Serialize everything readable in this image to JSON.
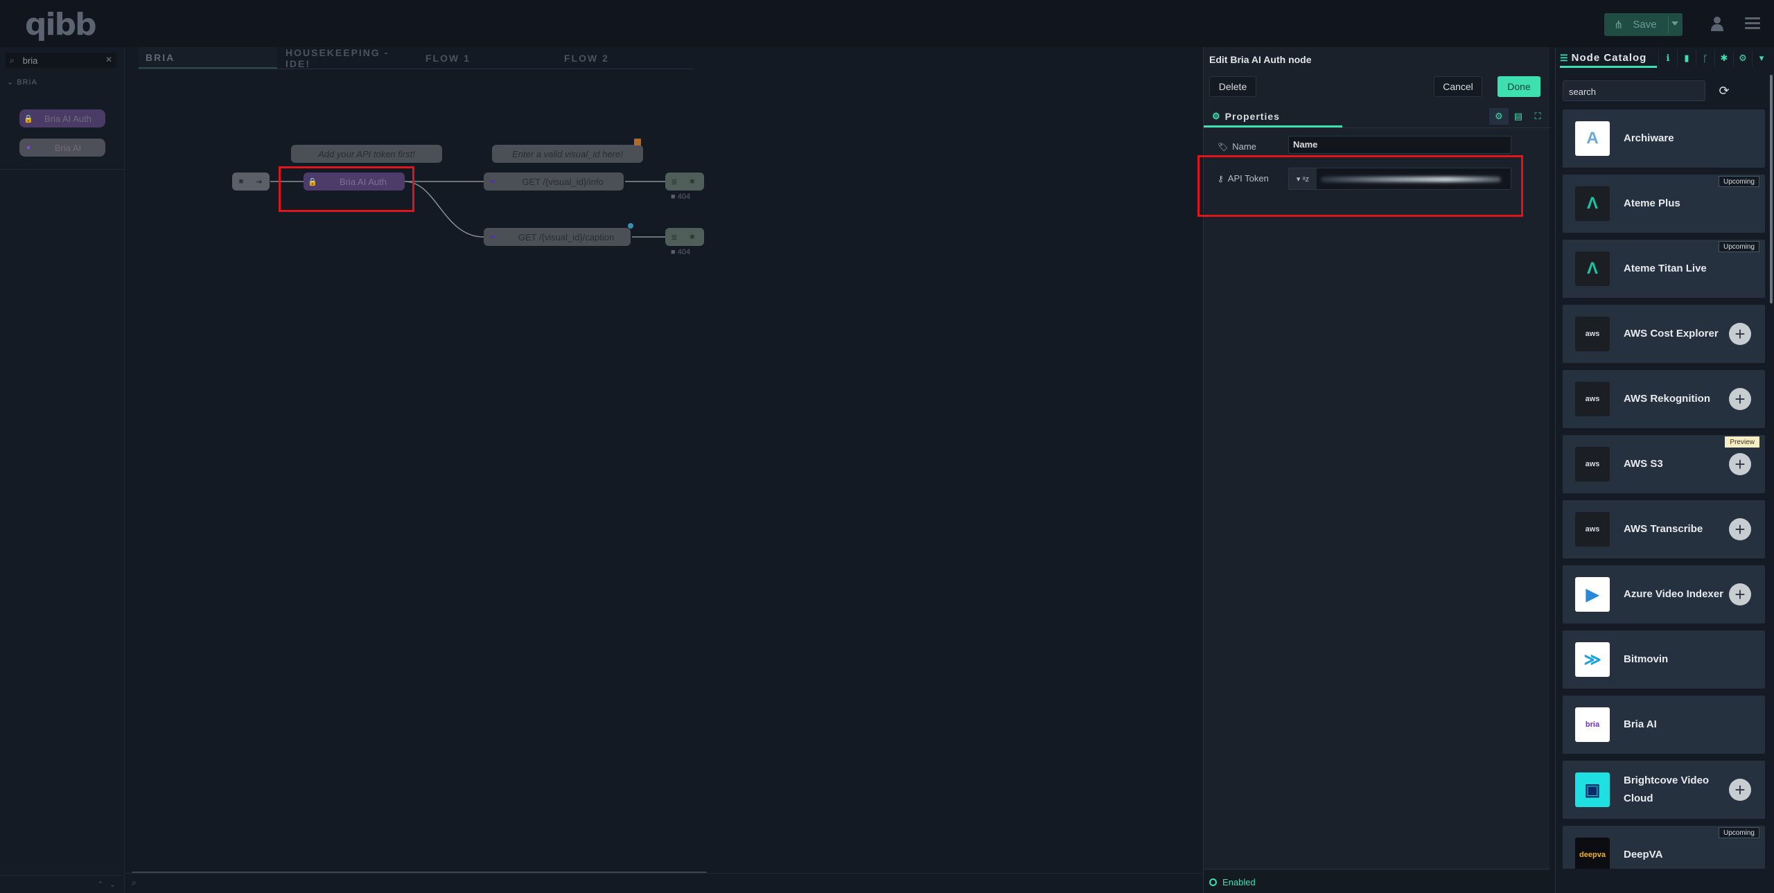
{
  "app": {
    "logo": "qibb"
  },
  "header": {
    "save_label": "Save"
  },
  "palette": {
    "search_value": "bria",
    "category": "BRIA",
    "nodes": [
      {
        "label": "Bria AI Auth"
      },
      {
        "label": "Bria AI"
      }
    ]
  },
  "workspace": {
    "tabs": [
      {
        "label": "BRIA"
      },
      {
        "label": "HOUSEKEEPING - IDE!"
      },
      {
        "label": "FLOW 1"
      },
      {
        "label": "FLOW 2"
      }
    ],
    "comments": [
      {
        "text": "Add your API token first!"
      },
      {
        "text": "Enter a valid visual_id here!"
      }
    ],
    "nodes": {
      "auth": "Bria AI Auth",
      "info": "GET /{visual_id}/info",
      "caption": "GET /{visual_id}/caption",
      "status_1": "404",
      "status_2": "404"
    }
  },
  "edit": {
    "title": "Edit Bria AI Auth node",
    "delete_label": "Delete",
    "cancel_label": "Cancel",
    "done_label": "Done",
    "properties_tab": "Properties",
    "name_label": "Name",
    "name_placeholder": "Name",
    "token_label": "API Token",
    "enabled_label": "Enabled"
  },
  "catalog": {
    "tab_label": "Node Catalog",
    "search_placeholder": "search",
    "items": [
      {
        "name": "Archiware",
        "logo": "A",
        "logo_bg": "#ffffff",
        "logo_color": "#6aa8d8",
        "add": false
      },
      {
        "name": "Ateme Plus",
        "logo": "Λ",
        "logo_bg": "#1b1f24",
        "logo_color": "#19c3a3",
        "badge": "Upcoming",
        "add": false
      },
      {
        "name": "Ateme Titan Live",
        "logo": "Λ",
        "logo_bg": "#1b1f24",
        "logo_color": "#19c3a3",
        "badge": "Upcoming",
        "add": false
      },
      {
        "name": "AWS Cost Explorer",
        "logo": "aws",
        "logo_bg": "#1b1f24",
        "logo_color": "#d9dde2",
        "add": true
      },
      {
        "name": "AWS Rekognition",
        "logo": "aws",
        "logo_bg": "#1b1f24",
        "logo_color": "#d9dde2",
        "add": true
      },
      {
        "name": "AWS S3",
        "logo": "aws",
        "logo_bg": "#1b1f24",
        "logo_color": "#d9dde2",
        "badge": "Preview",
        "add": true
      },
      {
        "name": "AWS Transcribe",
        "logo": "aws",
        "logo_bg": "#1b1f24",
        "logo_color": "#d9dde2",
        "add": true
      },
      {
        "name": "Azure Video Indexer",
        "logo": "▶",
        "logo_bg": "#ffffff",
        "logo_color": "#2a88d8",
        "add": true
      },
      {
        "name": "Bitmovin",
        "logo": "≫",
        "logo_bg": "#ffffff",
        "logo_color": "#1aa1e0",
        "add": false
      },
      {
        "name": "Bria AI",
        "logo": "bria",
        "logo_bg": "#ffffff",
        "logo_color": "#6b2fd0",
        "add": false
      },
      {
        "name": "Brightcove Video Cloud",
        "logo": "▣",
        "logo_bg": "#1ee0e0",
        "logo_color": "#0d2a6b",
        "add": true
      },
      {
        "name": "DeepVA",
        "logo": "deepva",
        "logo_bg": "#0b0d10",
        "logo_color": "#f0b020",
        "badge": "Upcoming",
        "add": false
      }
    ]
  }
}
